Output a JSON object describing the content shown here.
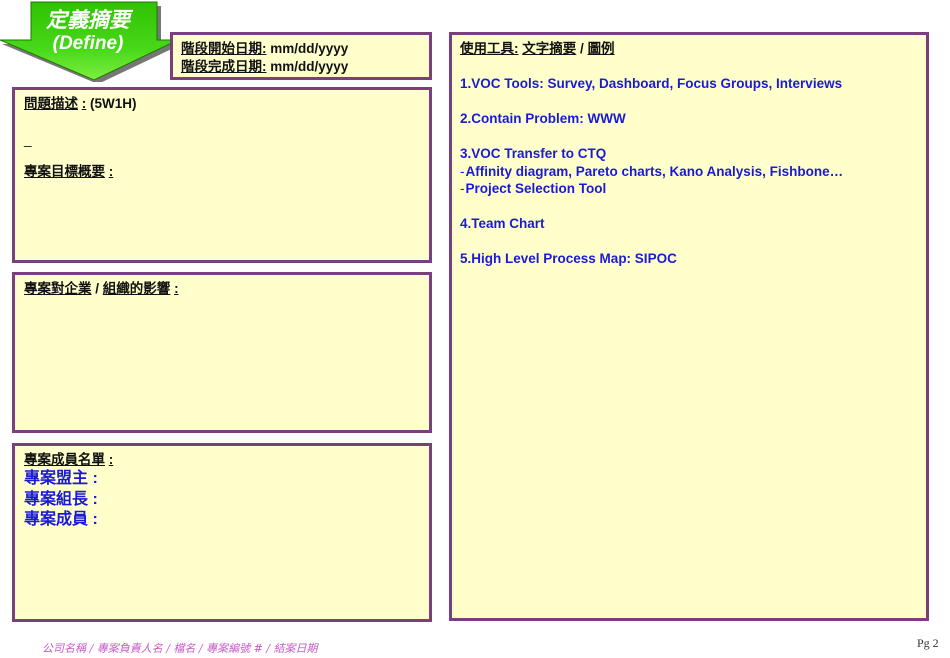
{
  "phase": {
    "title_zh": "定義摘要",
    "title_en": "(Define)",
    "arrow_color": "#33cc00"
  },
  "dates": {
    "start_label": "階段開始日期",
    "end_label": "階段完成日期",
    "colon": ":",
    "start_value": "mm/dd/yyyy",
    "end_value": "mm/dd/yyyy"
  },
  "problem": {
    "label": "問題描述",
    "colon": ":",
    "suffix": "(5W1H)",
    "blank_mark": "_",
    "goal_label": "專案目標概要"
  },
  "impact": {
    "label_a": "專案對企業",
    "slash": "/",
    "label_b": "組織的影響",
    "colon": ":"
  },
  "members": {
    "label": "專案成員名單",
    "colon": ":",
    "lines": [
      "專案盟主 :",
      "專案組長 :",
      "專案成員 :"
    ]
  },
  "tools": {
    "label_a": "使用工具",
    "colon": ":",
    "label_b": "文字摘要",
    "slash": "/",
    "label_c": "圖例",
    "items": [
      "1.VOC Tools: Survey, Dashboard, Focus Groups, Interviews",
      "2.Contain Problem: WWW",
      "3.VOC Transfer to CTQ",
      "4.Team Chart",
      "5.High Level Process Map: SIPOC"
    ],
    "sub_dash": "-",
    "sub_items": [
      "Affinity diagram, Pareto charts, Kano Analysis, Fishbone…",
      "Project Selection Tool"
    ]
  },
  "footer": {
    "text": "公司名稱 /  專案負責人名 / 檔名 / 專案編號 # / 結案日期",
    "page": "Pg 2"
  },
  "colors": {
    "box_bg": "#ffffcc",
    "box_border": "#7b3f7e",
    "accent_blue": "#1a1ad6",
    "footer_pink": "#c85ac8"
  }
}
